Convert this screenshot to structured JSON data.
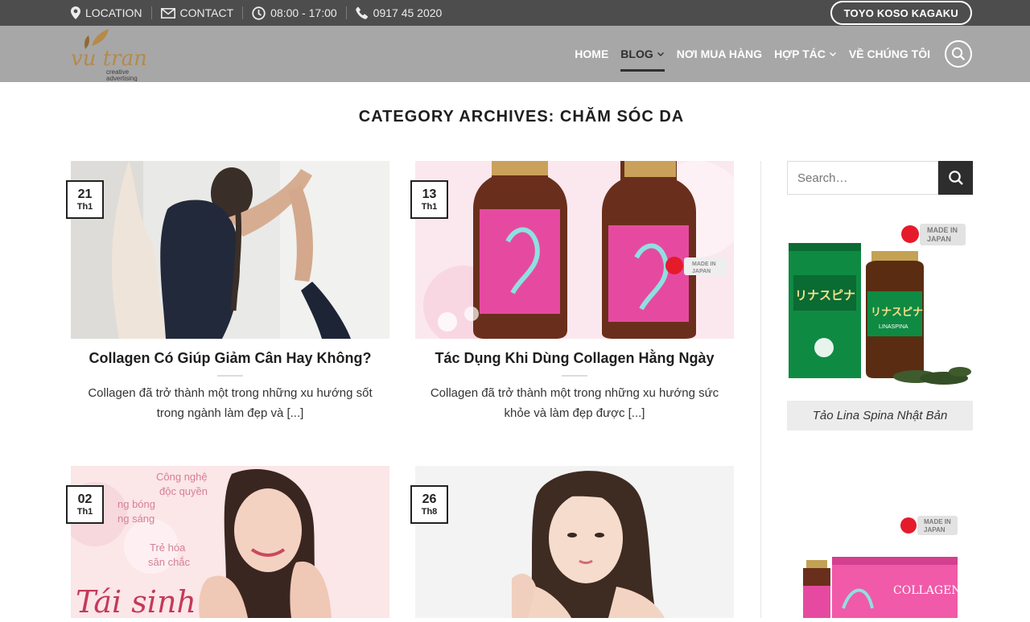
{
  "topbar": {
    "location": "LOCATION",
    "contact": "CONTACT",
    "hours": "08:00 - 17:00",
    "phone": "0917 45 2020",
    "cta": "TOYO KOSO KAGAKU"
  },
  "header": {
    "logo_alt": "Vu Tran creative advertising",
    "logo_line1": "creative",
    "logo_line2": "advertising",
    "nav": [
      {
        "label": "HOME"
      },
      {
        "label": "BLOG"
      },
      {
        "label": "NƠI MUA HÀNG"
      },
      {
        "label": "HỢP TÁC"
      },
      {
        "label": "VỀ CHÚNG TÔI"
      }
    ]
  },
  "page": {
    "title": "CATEGORY ARCHIVES: CHĂM SÓC DA"
  },
  "posts": [
    {
      "day": "21",
      "month": "Th1",
      "title": "Collagen Có Giúp Giảm Cân Hay Không?",
      "excerpt": "Collagen đã trở thành một trong những xu hướng sốt trong ngành làm đẹp và [...]"
    },
    {
      "day": "13",
      "month": "Th1",
      "title": "Tác Dụng Khi Dùng Collagen Hằng Ngày",
      "excerpt": "Collagen đã trở thành một trong những xu hướng sức khỏe và làm đẹp được [...]"
    },
    {
      "day": "02",
      "month": "Th1",
      "thumb_texts": [
        "Công nghệ",
        "độc quyền",
        "ng bóng",
        "ng sáng",
        "Trẻ hóa",
        "săn chắc",
        "Tái sinh"
      ]
    },
    {
      "day": "26",
      "month": "Th8"
    }
  ],
  "sidebar": {
    "search_placeholder": "Search…",
    "product1_caption": "Tảo Lina Spina Nhật Bản",
    "made_in_line1": "MADE IN",
    "made_in_line2": "JAPAN",
    "product1_label": "リナスピナ",
    "product1_sub": "LINASPINA",
    "product2_label": "COLLAGEN"
  },
  "colors": {
    "topbar_bg": "#4d4d4d",
    "header_bg": "#a7a7a7",
    "nav_active": "#2f2f2f",
    "search_btn": "#2d2d2d",
    "caption_bg": "#ececec"
  }
}
